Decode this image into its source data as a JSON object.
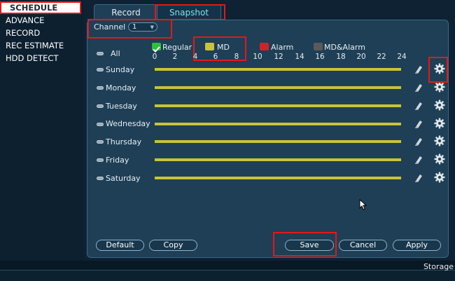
{
  "sidebar": {
    "items": [
      {
        "label": "SCHEDULE",
        "active": true
      },
      {
        "label": "ADVANCE"
      },
      {
        "label": "RECORD"
      },
      {
        "label": "REC ESTIMATE"
      },
      {
        "label": "HDD DETECT"
      }
    ]
  },
  "tabs": [
    {
      "label": "Record",
      "active": false
    },
    {
      "label": "Snapshot",
      "active": true
    }
  ],
  "channel": {
    "label": "Channel",
    "value": "1"
  },
  "all_label": "All",
  "legend": [
    {
      "label": "Regular",
      "color": "#2fbf3a",
      "checked": true
    },
    {
      "label": "MD",
      "color": "#c8c33a"
    },
    {
      "label": "Alarm",
      "color": "#d4202a"
    },
    {
      "label": "MD&Alarm",
      "color": "#5a5a5a"
    }
  ],
  "hours": [
    "0",
    "2",
    "4",
    "6",
    "8",
    "10",
    "12",
    "14",
    "16",
    "18",
    "20",
    "22",
    "24"
  ],
  "days": [
    "Sunday",
    "Monday",
    "Tuesday",
    "Wednesday",
    "Thursday",
    "Friday",
    "Saturday"
  ],
  "schedule_color": "#c8c33a",
  "buttons": {
    "default": "Default",
    "copy": "Copy",
    "save": "Save",
    "cancel": "Cancel",
    "apply": "Apply"
  },
  "status_bar": {
    "storage": "Storage"
  },
  "icons": {
    "row_edit": "pencil-icon",
    "row_settings": "gear-icon"
  }
}
